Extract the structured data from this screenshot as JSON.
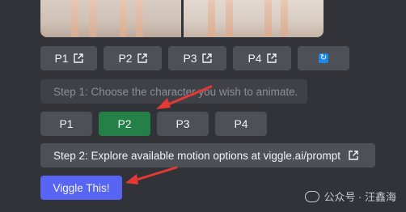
{
  "row1": {
    "buttons": [
      {
        "label": "P1"
      },
      {
        "label": "P2"
      },
      {
        "label": "P3"
      },
      {
        "label": "P4"
      }
    ]
  },
  "step1": {
    "label": "Step 1: Choose the character you wish to animate."
  },
  "row2": {
    "buttons": [
      {
        "label": "P1",
        "style": "secondary"
      },
      {
        "label": "P2",
        "style": "success"
      },
      {
        "label": "P3",
        "style": "secondary"
      },
      {
        "label": "P4",
        "style": "secondary"
      }
    ]
  },
  "step2": {
    "label": "Step 2: Explore available motion options at viggle.ai/prompt"
  },
  "action": {
    "label": "Viggle This!"
  },
  "watermark": {
    "text": "公众号 · 汪鑫海"
  },
  "colors": {
    "background": "#313338",
    "secondary_button": "#4e5058",
    "success_button": "#248046",
    "primary_button": "#5865f2",
    "arrow": "#e53935"
  },
  "icons": [
    "external-link-icon",
    "refresh-icon",
    "red-arrow-annotation",
    "wechat-icon"
  ]
}
